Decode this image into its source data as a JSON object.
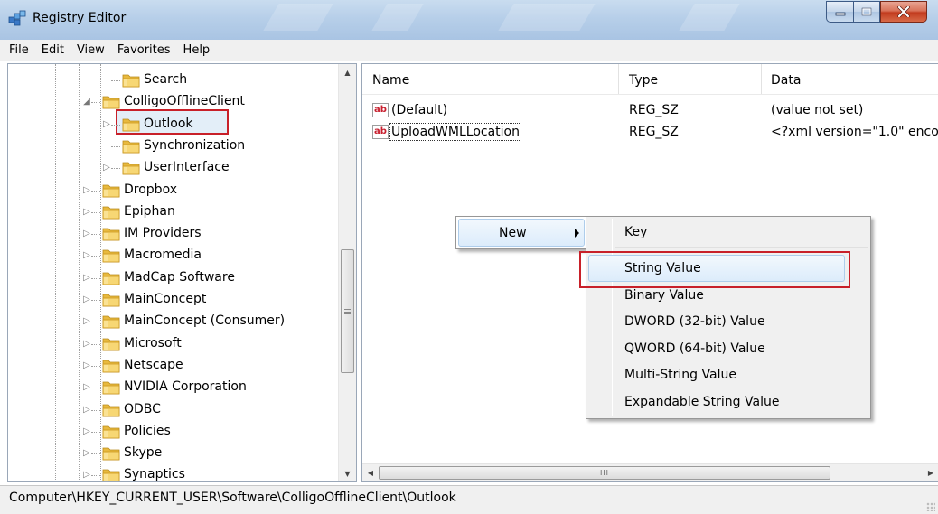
{
  "window": {
    "title": "Registry Editor"
  },
  "menubar": {
    "items": [
      "File",
      "Edit",
      "View",
      "Favorites",
      "Help"
    ]
  },
  "tree": {
    "items": [
      {
        "label": "Search",
        "level": 2,
        "expander": "none"
      },
      {
        "label": "ColligoOfflineClient",
        "level": 1,
        "expander": "expanded"
      },
      {
        "label": "Outlook",
        "level": 2,
        "expander": "collapsed",
        "selected": true
      },
      {
        "label": "Synchronization",
        "level": 2,
        "expander": "none"
      },
      {
        "label": "UserInterface",
        "level": 2,
        "expander": "collapsed"
      },
      {
        "label": "Dropbox",
        "level": 1,
        "expander": "collapsed"
      },
      {
        "label": "Epiphan",
        "level": 1,
        "expander": "collapsed"
      },
      {
        "label": "IM Providers",
        "level": 1,
        "expander": "collapsed"
      },
      {
        "label": "Macromedia",
        "level": 1,
        "expander": "collapsed"
      },
      {
        "label": "MadCap Software",
        "level": 1,
        "expander": "collapsed"
      },
      {
        "label": "MainConcept",
        "level": 1,
        "expander": "collapsed"
      },
      {
        "label": "MainConcept (Consumer)",
        "level": 1,
        "expander": "collapsed"
      },
      {
        "label": "Microsoft",
        "level": 1,
        "expander": "collapsed"
      },
      {
        "label": "Netscape",
        "level": 1,
        "expander": "collapsed"
      },
      {
        "label": "NVIDIA Corporation",
        "level": 1,
        "expander": "collapsed"
      },
      {
        "label": "ODBC",
        "level": 1,
        "expander": "collapsed"
      },
      {
        "label": "Policies",
        "level": 1,
        "expander": "collapsed"
      },
      {
        "label": "Skype",
        "level": 1,
        "expander": "collapsed"
      },
      {
        "label": "Synaptics",
        "level": 1,
        "expander": "collapsed"
      }
    ]
  },
  "values": {
    "columns": {
      "name": "Name",
      "type": "Type",
      "data": "Data"
    },
    "rows": [
      {
        "name": "(Default)",
        "type": "REG_SZ",
        "data": "(value not set)",
        "icon": "ab-string-icon"
      },
      {
        "name": "UploadWMLLocation",
        "type": "REG_SZ",
        "data": "<?xml version=\"1.0\" enco",
        "icon": "ab-string-icon"
      }
    ]
  },
  "context_menu": {
    "new_label": "New",
    "submenu": [
      "Key",
      "String Value",
      "Binary Value",
      "DWORD (32-bit) Value",
      "QWORD (64-bit) Value",
      "Multi-String Value",
      "Expandable String Value"
    ],
    "highlighted": "String Value"
  },
  "statusbar": {
    "path": "Computer\\HKEY_CURRENT_USER\\Software\\ColligoOfflineClient\\Outlook"
  },
  "colors": {
    "highlight_box": "#c82029",
    "titlebar": "#b7cfe9",
    "menu_hover": "#dcecfb"
  }
}
